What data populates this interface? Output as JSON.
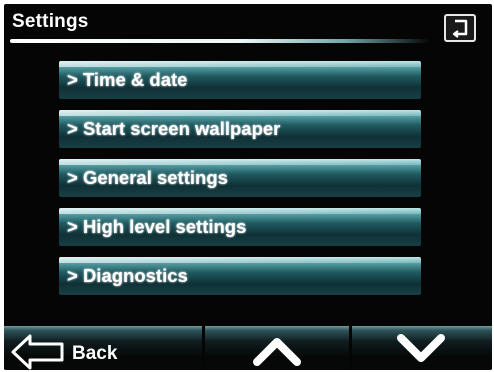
{
  "header": {
    "title": "Settings",
    "return_icon": "return-arrow-icon"
  },
  "menu": {
    "items": [
      {
        "label": "> Time & date"
      },
      {
        "label": "> Start screen wallpaper"
      },
      {
        "label": "> General settings"
      },
      {
        "label": "> High level settings"
      },
      {
        "label": "> Diagnostics"
      }
    ]
  },
  "footer": {
    "back_label": "Back",
    "back_icon": "back-arrow-icon",
    "up_icon": "chevron-up-icon",
    "down_icon": "chevron-down-icon"
  },
  "colors": {
    "background": "#050505",
    "accent_teal": "#5eaab0",
    "text": "#ffffff"
  }
}
